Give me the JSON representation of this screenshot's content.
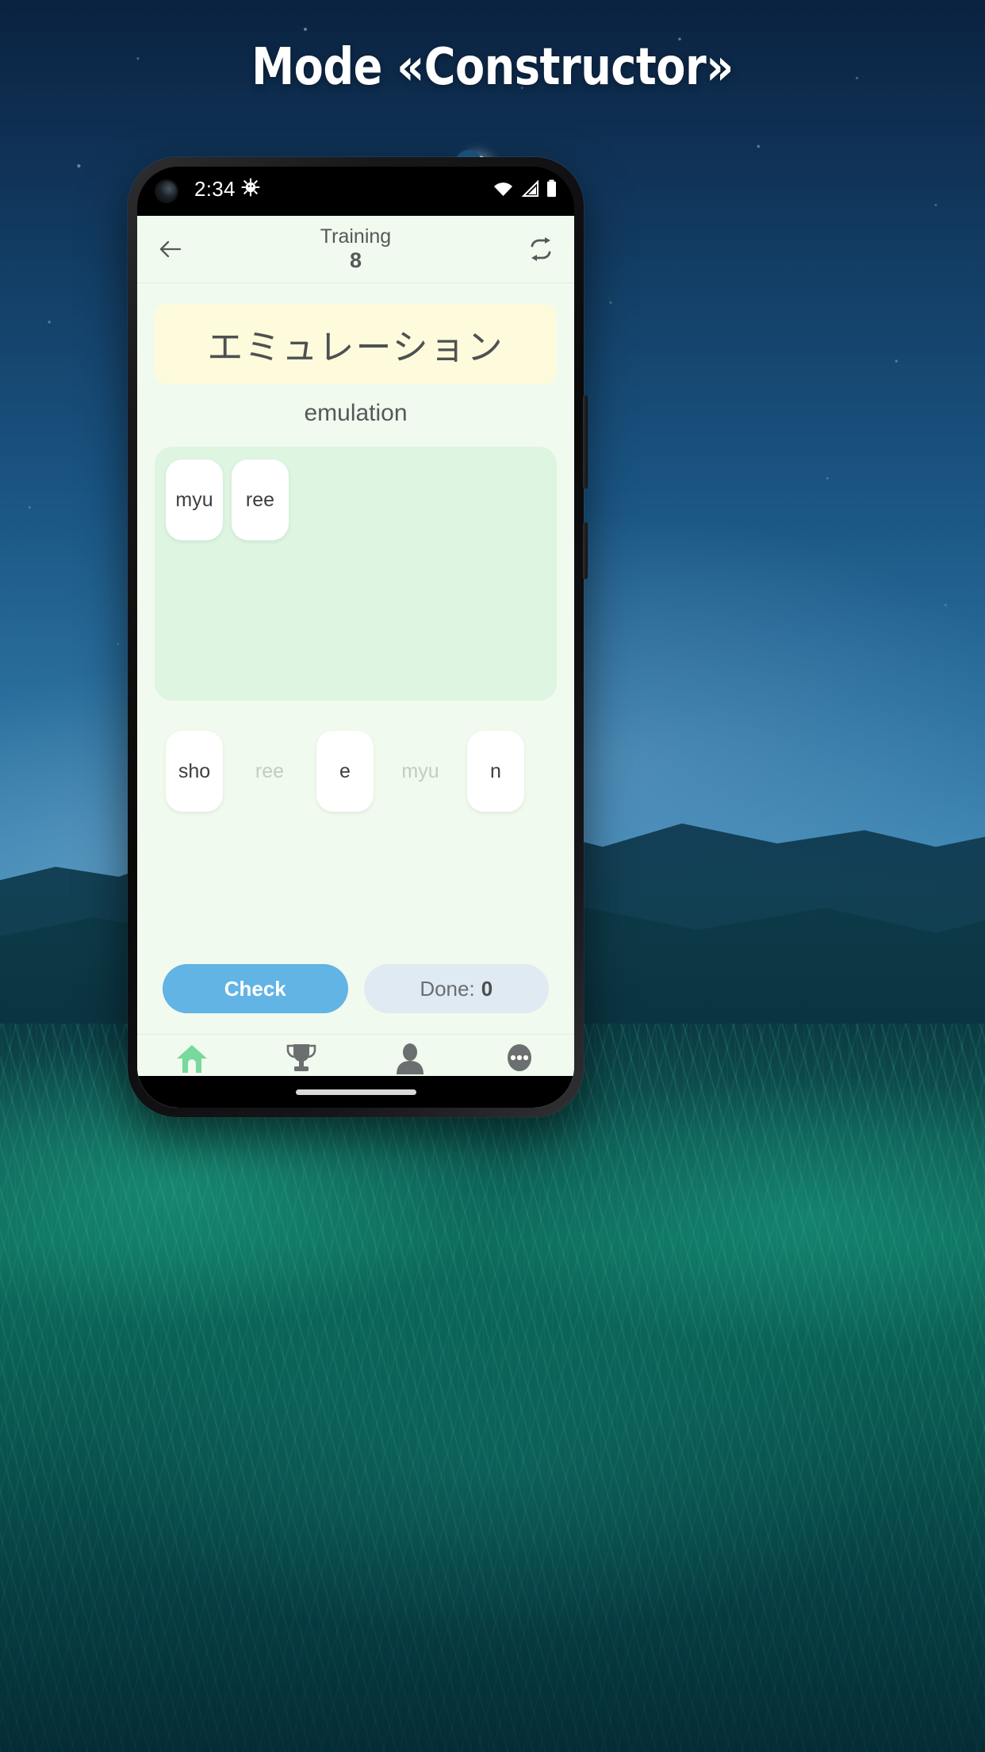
{
  "promo": {
    "headline": "Mode «Constructor»"
  },
  "statusbar": {
    "time": "2:34",
    "icons": [
      "android-debug-icon",
      "wifi-icon",
      "cell-signal-icon",
      "battery-icon"
    ]
  },
  "appbar": {
    "back_icon": "arrow-left-icon",
    "title": "Training",
    "count": "8",
    "refresh_icon": "repeat-icon"
  },
  "card": {
    "word_jp": "エミュレーション",
    "word_en": "emulation"
  },
  "answer": {
    "tiles": [
      {
        "label": "myu"
      },
      {
        "label": "ree"
      }
    ]
  },
  "source": {
    "tiles": [
      {
        "label": "sho",
        "used": false
      },
      {
        "label": "ree",
        "used": true
      },
      {
        "label": "e",
        "used": false
      },
      {
        "label": "myu",
        "used": true
      },
      {
        "label": "n",
        "used": false
      }
    ]
  },
  "actions": {
    "check_label": "Check",
    "done_label": "Done:",
    "done_count": "0"
  },
  "bottomnav": {
    "items": [
      {
        "label": "Study",
        "icon": "home-icon",
        "active": true
      },
      {
        "label": "Competitions",
        "icon": "trophy-icon",
        "active": false
      },
      {
        "label": "Profile",
        "icon": "person-icon",
        "active": false
      },
      {
        "label": "Menu",
        "icon": "ellipsis-icon",
        "active": false
      }
    ]
  },
  "colors": {
    "app_background": "#f1faee",
    "word_card": "#fdfbdb",
    "answer_panel": "#ddf5e1",
    "check_button": "#61b4e4",
    "done_button": "#e0eaf2",
    "active_nav": "#4fc17c",
    "text": "#55595a"
  }
}
